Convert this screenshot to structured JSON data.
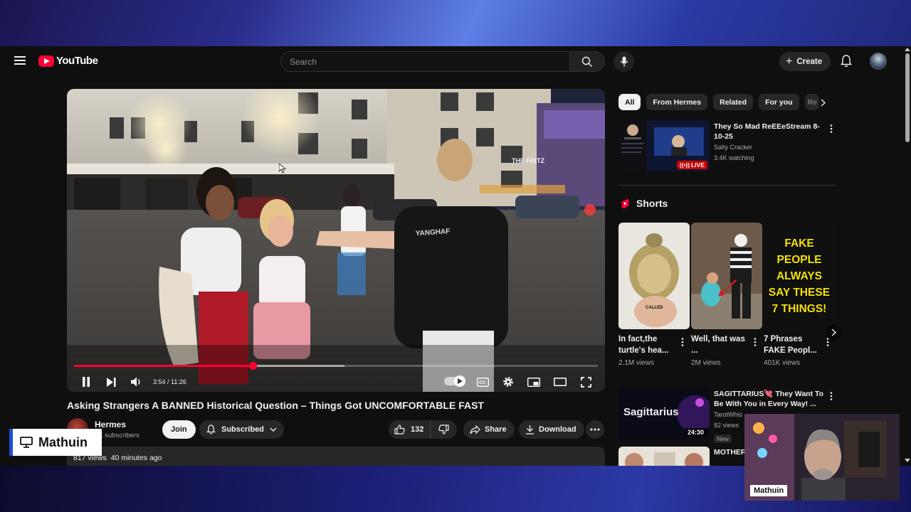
{
  "header": {
    "logo_text": "YouTube",
    "search_placeholder": "Search",
    "create_label": "Create"
  },
  "player": {
    "current_time": "3:54",
    "duration": "11:26",
    "time_display": "3:54 / 11:26",
    "progress_fraction": 0.341,
    "buffer_fraction": 0.516,
    "sign_text": "THE FRITZ",
    "shirt_text": "YANGHAF"
  },
  "video": {
    "title": "Asking Strangers A BANNED Historical Question – Things Got UNCOMFORTABLE FAST",
    "channel_name": "Hermes",
    "subscribers": "8K subscribers",
    "join_label": "Join",
    "subscribed_label": "Subscribed",
    "like_count": "132",
    "share_label": "Share",
    "download_label": "Download",
    "views": "817 views",
    "posted": "40 minutes ago"
  },
  "sidebar": {
    "chips": [
      {
        "label": "All",
        "active": true
      },
      {
        "label": "From Hermes",
        "active": false
      },
      {
        "label": "Related",
        "active": false
      },
      {
        "label": "For you",
        "active": false
      },
      {
        "label": "Re",
        "active": false
      }
    ],
    "live_rec": {
      "title": "They So Mad ReEEeStream 8-10-25",
      "channel": "Salty Cracker",
      "watching": "3.4K watching",
      "badge": "LIVE"
    },
    "shorts_heading": "Shorts",
    "shorts": [
      {
        "title": "In fact,the turtle's hea...",
        "views": "2.1M views",
        "caption": "CALLED"
      },
      {
        "title": "Well, that was ...",
        "views": "2M views",
        "caption": ""
      },
      {
        "title": "7 Phrases FAKE Peopl...",
        "views": "401K views",
        "caption": "FAKE PEOPLE ALWAYS SAY THESE 7 THINGS!"
      }
    ],
    "rec2": {
      "title": "SAGITTARIUS💘 They Want To Be With You in Every Way! ...",
      "channel": "TarotWhis",
      "views": "82 views",
      "badge": "New",
      "duration": "24:30",
      "thumb_text": "Sagittarius"
    },
    "rec3": {
      "title": "MOTHER... ALONE T..."
    }
  },
  "overlay": {
    "stream_label": "Mathuin",
    "webcam_name": "Mathuin"
  },
  "colors": {
    "accent": "#ff0033",
    "background": "#0f0f0f",
    "chip_bg": "#272727"
  }
}
